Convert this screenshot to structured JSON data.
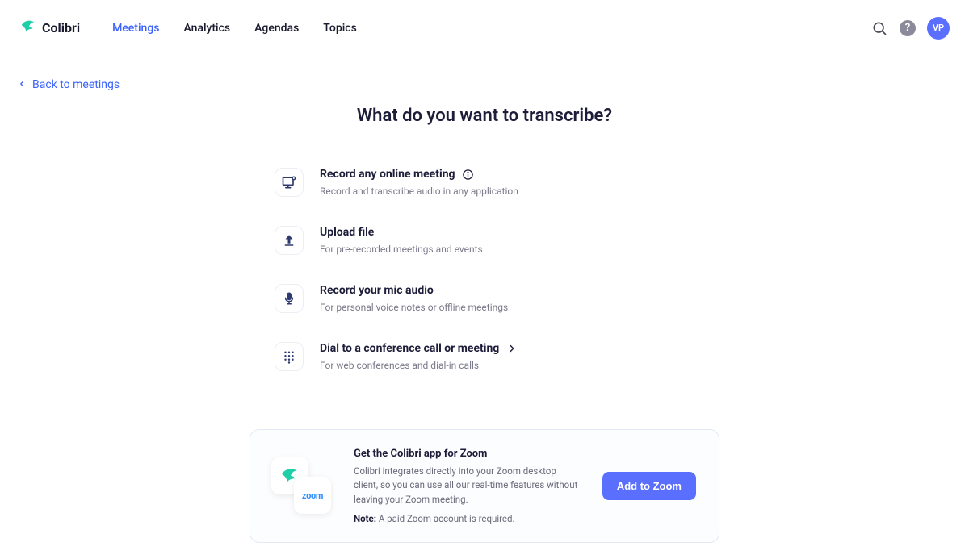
{
  "brand": {
    "name": "Colibri"
  },
  "nav": {
    "items": [
      {
        "label": "Meetings",
        "active": true
      },
      {
        "label": "Analytics",
        "active": false
      },
      {
        "label": "Agendas",
        "active": false
      },
      {
        "label": "Topics",
        "active": false
      }
    ]
  },
  "user": {
    "initials": "VP"
  },
  "back": {
    "label": "Back to meetings"
  },
  "heading": "What do you want to transcribe?",
  "options": [
    {
      "icon": "monitor-record",
      "title": "Record any online meeting",
      "desc": "Record and transcribe audio in any application",
      "trailing": "info"
    },
    {
      "icon": "upload",
      "title": "Upload file",
      "desc": "For pre-recorded meetings and events",
      "trailing": null
    },
    {
      "icon": "mic",
      "title": "Record your mic audio",
      "desc": "For personal voice notes or offline meetings",
      "trailing": null
    },
    {
      "icon": "dialpad",
      "title": "Dial to a conference call or meeting",
      "desc": "For web conferences and dial-in calls",
      "trailing": "chevron"
    }
  ],
  "promo": {
    "title": "Get the Colibri app for Zoom",
    "desc": "Colibri integrates directly into your Zoom desktop client, so you can use all our real-time features without leaving your Zoom meeting.",
    "note_label": "Note:",
    "note_text": "A paid Zoom account is required.",
    "button": "Add to Zoom",
    "zoom_label": "zoom"
  }
}
